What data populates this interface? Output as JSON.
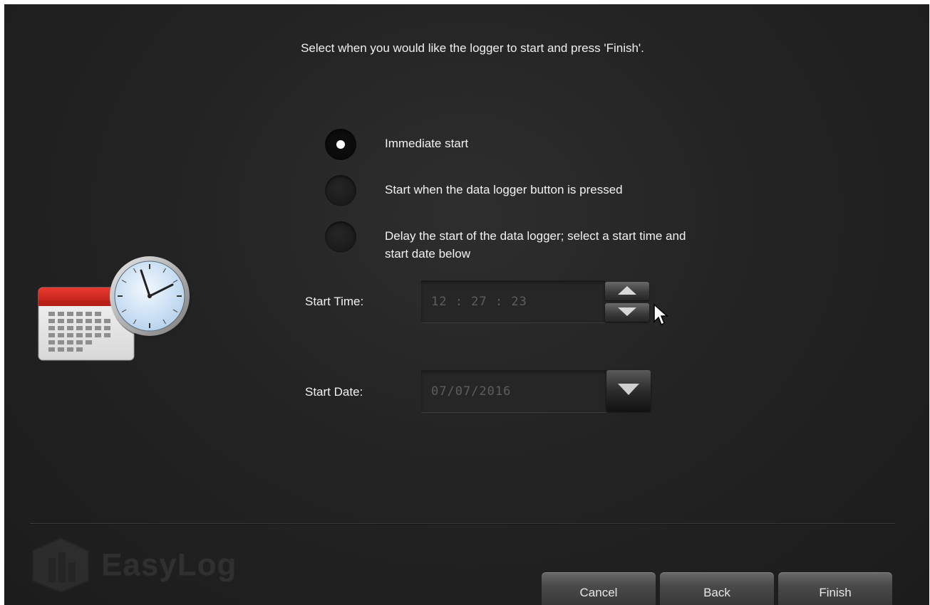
{
  "instruction": "Select when you would like the logger to start and press 'Finish'.",
  "start_options": [
    {
      "label": "Immediate start",
      "selected": true
    },
    {
      "label": "Start when the data logger button is pressed",
      "selected": false
    },
    {
      "label": "Delay the start of the data logger; select a start time and start date below",
      "selected": false
    }
  ],
  "start_time": {
    "label": "Start Time:",
    "value": "12 : 27 : 23"
  },
  "start_date": {
    "label": "Start Date:",
    "value": "07/07/2016"
  },
  "logo": {
    "text": "EasyLog"
  },
  "buttons": {
    "cancel": "Cancel",
    "back": "Back",
    "finish": "Finish"
  },
  "icons": {
    "calendar_clock": "calendar-clock-icon",
    "spin_up": "triangle-up-icon",
    "spin_down": "triangle-down-icon",
    "dropdown": "triangle-down-icon",
    "logo_mark": "easylog-logo-icon",
    "cursor": "mouse-pointer-icon"
  },
  "colors": {
    "background": "#232323",
    "text": "#f2f2f2",
    "disabled_text": "#5e5e5e",
    "calendar_red": "#d42a20",
    "clock_face": "#cfe3f5"
  }
}
